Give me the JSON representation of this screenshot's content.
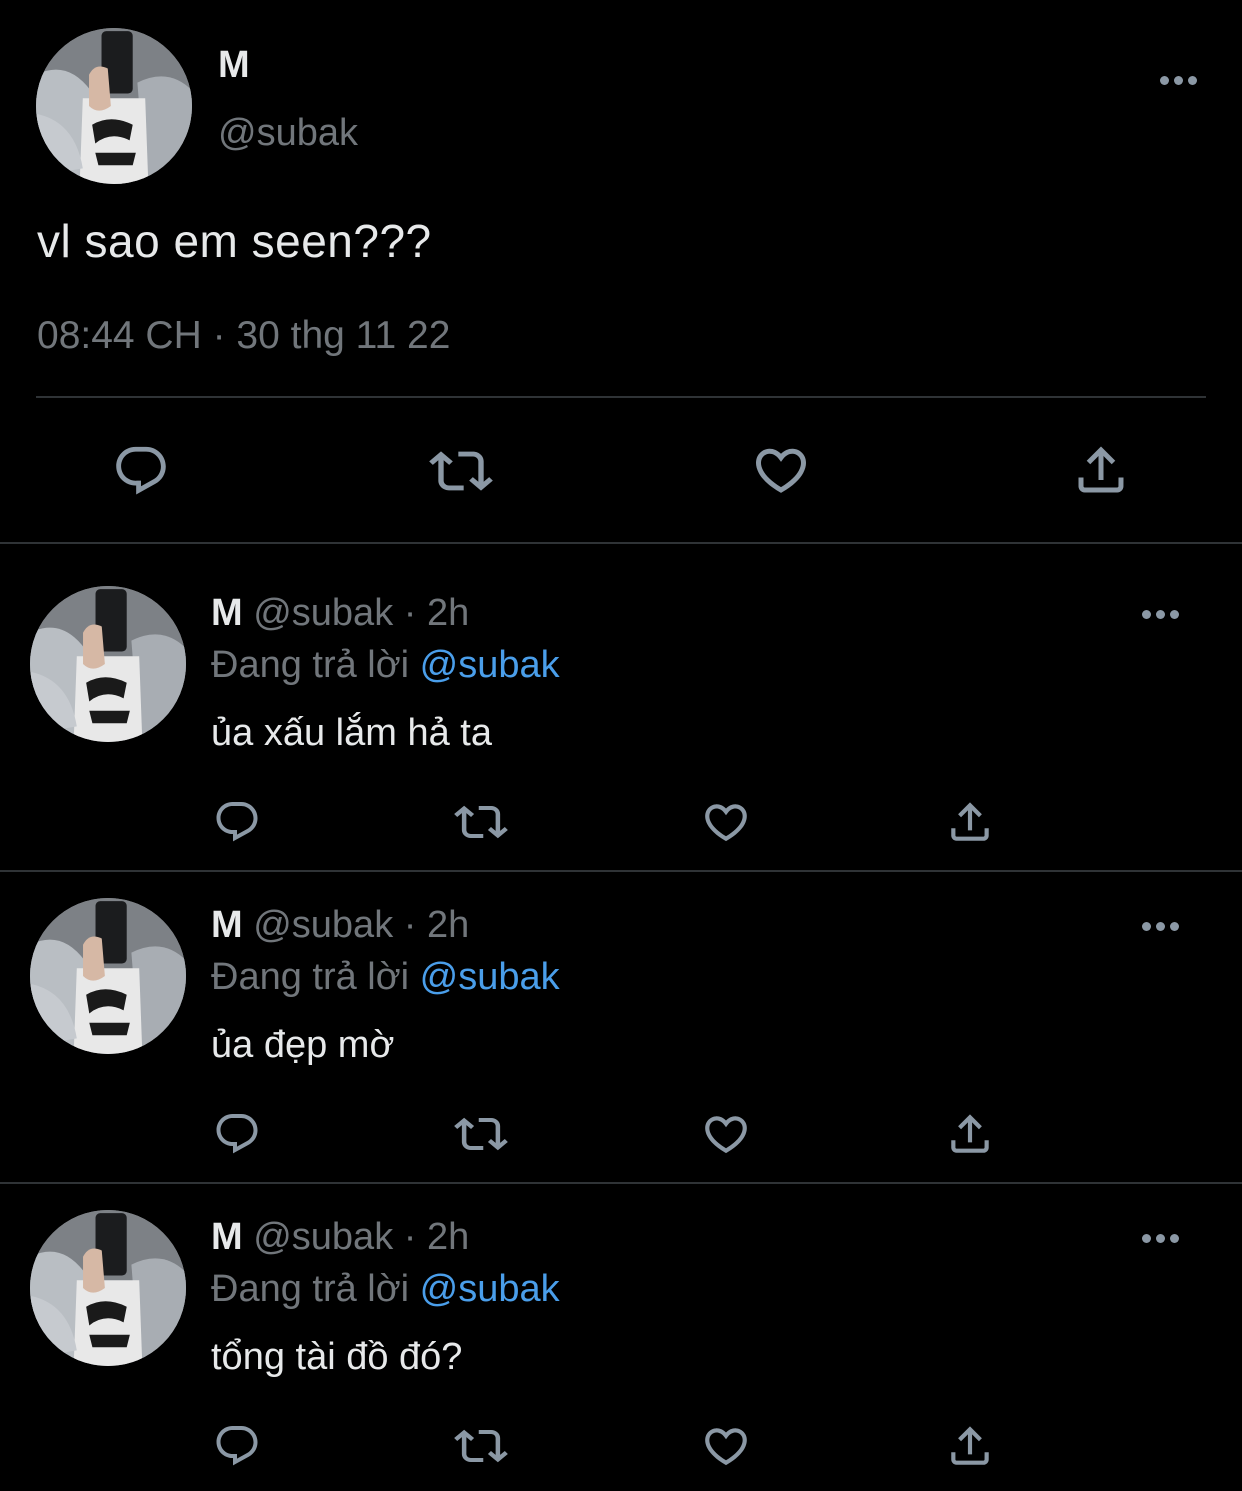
{
  "main_tweet": {
    "name": "M",
    "handle": "@subak",
    "text": "vl sao em seen???",
    "timestamp": "08:44 CH · 30 thg 11 22",
    "actions": [
      "reply-icon",
      "retweet-icon",
      "like-icon",
      "share-icon"
    ]
  },
  "replies": [
    {
      "name": "M",
      "handle_time": "@subak · 2h",
      "replying_prefix": "Đang trả lời",
      "mention": "@subak",
      "text": "ủa xấu lắm hả ta"
    },
    {
      "name": "M",
      "handle_time": "@subak · 2h",
      "replying_prefix": "Đang trả lời",
      "mention": "@subak",
      "text": "ủa đẹp mờ"
    },
    {
      "name": "M",
      "handle_time": "@subak · 2h",
      "replying_prefix": "Đang trả lời",
      "mention": "@subak",
      "text": "tổng tài đồ đó?"
    }
  ],
  "colors": {
    "background": "#000000",
    "text": "#e7e9ea",
    "secondary": "#71767b",
    "mention": "#4a9eea",
    "divider": "#2f3336"
  }
}
